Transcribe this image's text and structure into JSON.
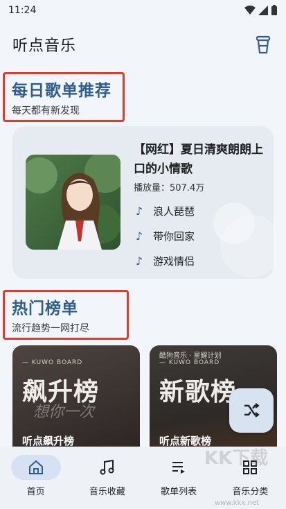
{
  "status_bar": {
    "time": "11:24"
  },
  "app_bar": {
    "title": "听点音乐",
    "action_icon": "bin-icon"
  },
  "daily": {
    "title": "每日歌单推荐",
    "subtitle": "每天都有新发现"
  },
  "recommend": {
    "title": "【网红】夏日清爽朗朗上口的小情歌",
    "play_count": "播放量：507.4万",
    "songs": [
      "浪人琵琶",
      "带你回家",
      "游戏情侣"
    ]
  },
  "hot": {
    "title": "热门榜单",
    "subtitle": "流行趋势一网打尽"
  },
  "charts": [
    {
      "board": "— KUWO BOARD",
      "top_text": "",
      "big": "飙升榜",
      "faint": "想你一次",
      "name": "听点飙升榜"
    },
    {
      "board": "— KUWO BOARD",
      "top_text": "酷狗音乐 · 星耀计划",
      "big": "新歌榜",
      "faint": "",
      "name": "听点新歌榜"
    }
  ],
  "fab": {
    "icon": "shuffle-icon"
  },
  "nav": [
    {
      "label": "首页",
      "icon": "home-icon",
      "active": true
    },
    {
      "label": "音乐收藏",
      "icon": "music-note-icon",
      "active": false
    },
    {
      "label": "歌单列表",
      "icon": "playlist-icon",
      "active": false
    },
    {
      "label": "音乐分类",
      "icon": "grid-icon",
      "active": false
    }
  ],
  "watermark": {
    "text": "KK下载",
    "url": "www.kkx.net"
  },
  "colors": {
    "accent": "#2f5e8c",
    "highlight_border": "#e23a2f",
    "nav_active": "#d6e2f3"
  }
}
